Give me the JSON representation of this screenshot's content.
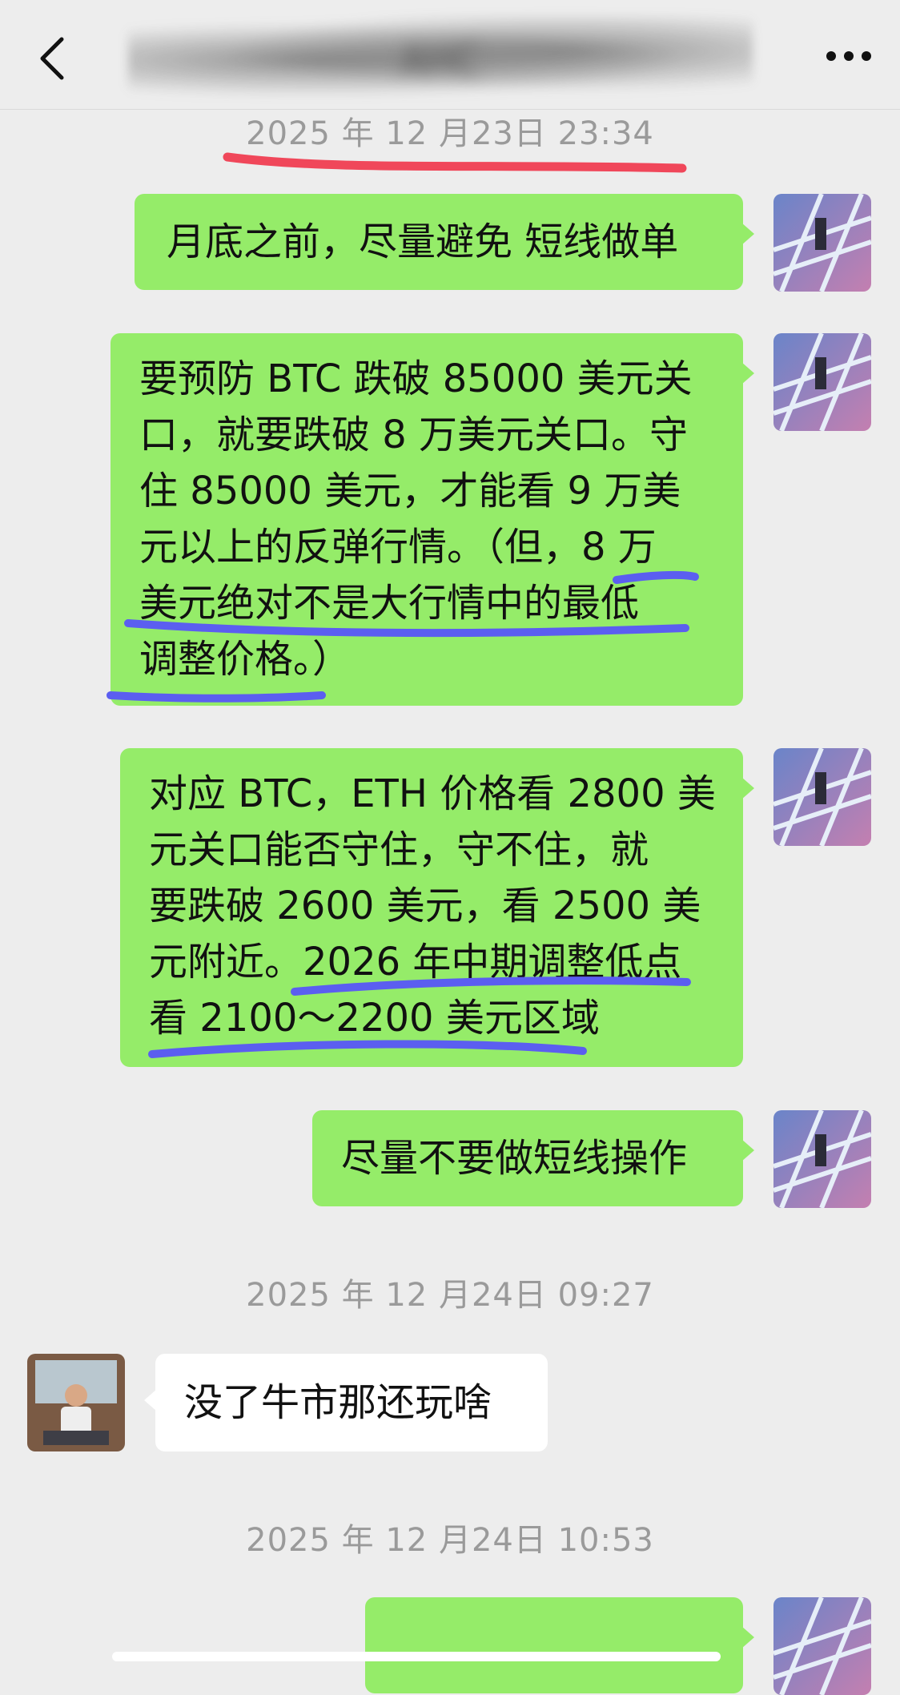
{
  "header": {
    "title": "AHC",
    "back_icon": "chevron-left-icon",
    "more_icon": "more-dots-icon"
  },
  "messages": [
    {
      "type": "time",
      "text": "2025 年 12 月23日 23:34"
    },
    {
      "type": "me",
      "lines": [
        "月底之前，尽量避免 短线做单"
      ]
    },
    {
      "type": "me",
      "lines": [
        "要预防 BTC 跌破 85000 美元关",
        "口，就要跌破 8 万美元关口。守",
        "住 85000 美元，才能看 9 万美",
        "元以上的反弹行情。（但，8 万",
        "美元绝对不是大行情中的最低",
        "调整价格。）"
      ]
    },
    {
      "type": "me",
      "lines": [
        "对应 BTC，ETH 价格看 2800 美",
        "元关口能否守住，守不住，就",
        "要跌破 2600 美元，看 2500 美",
        "元附近。2026 年中期调整低点",
        "看 2100～2200 美元区域"
      ]
    },
    {
      "type": "me",
      "lines": [
        "尽量不要做短线操作"
      ]
    },
    {
      "type": "time",
      "text": "2025 年 12 月24日 09:27"
    },
    {
      "type": "them",
      "lines": [
        "没了牛市那还玩啥"
      ]
    },
    {
      "type": "time",
      "text": "2025 年 12 月24日 10:53"
    }
  ],
  "colors": {
    "background": "#ededed",
    "my_bubble": "#95ec69",
    "their_bubble": "#ffffff",
    "timestamp": "#9a9a9a",
    "red_underline": "#f0475a",
    "blue_underline": "#5b5ef0"
  }
}
